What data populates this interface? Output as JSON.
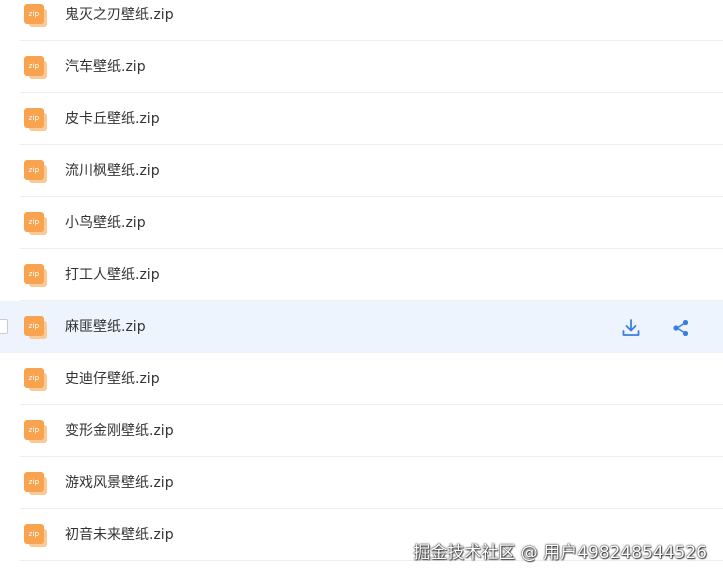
{
  "file_list": {
    "items": [
      {
        "name": "鬼灭之刃壁纸.zip",
        "icon": "zip-file-icon",
        "badge": "zip"
      },
      {
        "name": "汽车壁纸.zip",
        "icon": "zip-file-icon",
        "badge": "zip"
      },
      {
        "name": "皮卡丘壁纸.zip",
        "icon": "zip-file-icon",
        "badge": "zip"
      },
      {
        "name": "流川枫壁纸.zip",
        "icon": "zip-file-icon",
        "badge": "zip"
      },
      {
        "name": "小鸟壁纸.zip",
        "icon": "zip-file-icon",
        "badge": "zip"
      },
      {
        "name": "打工人壁纸.zip",
        "icon": "zip-file-icon",
        "badge": "zip"
      },
      {
        "name": "麻匪壁纸.zip",
        "icon": "zip-file-icon",
        "badge": "zip",
        "hovered": true
      },
      {
        "name": "史迪仔壁纸.zip",
        "icon": "zip-file-icon",
        "badge": "zip"
      },
      {
        "name": "变形金刚壁纸.zip",
        "icon": "zip-file-icon",
        "badge": "zip"
      },
      {
        "name": "游戏风景壁纸.zip",
        "icon": "zip-file-icon",
        "badge": "zip"
      },
      {
        "name": "初音未来壁纸.zip",
        "icon": "zip-file-icon",
        "badge": "zip"
      }
    ],
    "hover_actions": [
      {
        "name": "download",
        "icon": "download-icon"
      },
      {
        "name": "share",
        "icon": "share-icon"
      }
    ]
  },
  "watermark": {
    "text": "掘金技术社区 @ 用户498248544526"
  },
  "colors": {
    "accent": "#3b7ee0",
    "hover_row_bg": "#eef4fd",
    "zip_icon": "#f7a34f",
    "divider": "#eeeeee",
    "text": "#333333"
  }
}
